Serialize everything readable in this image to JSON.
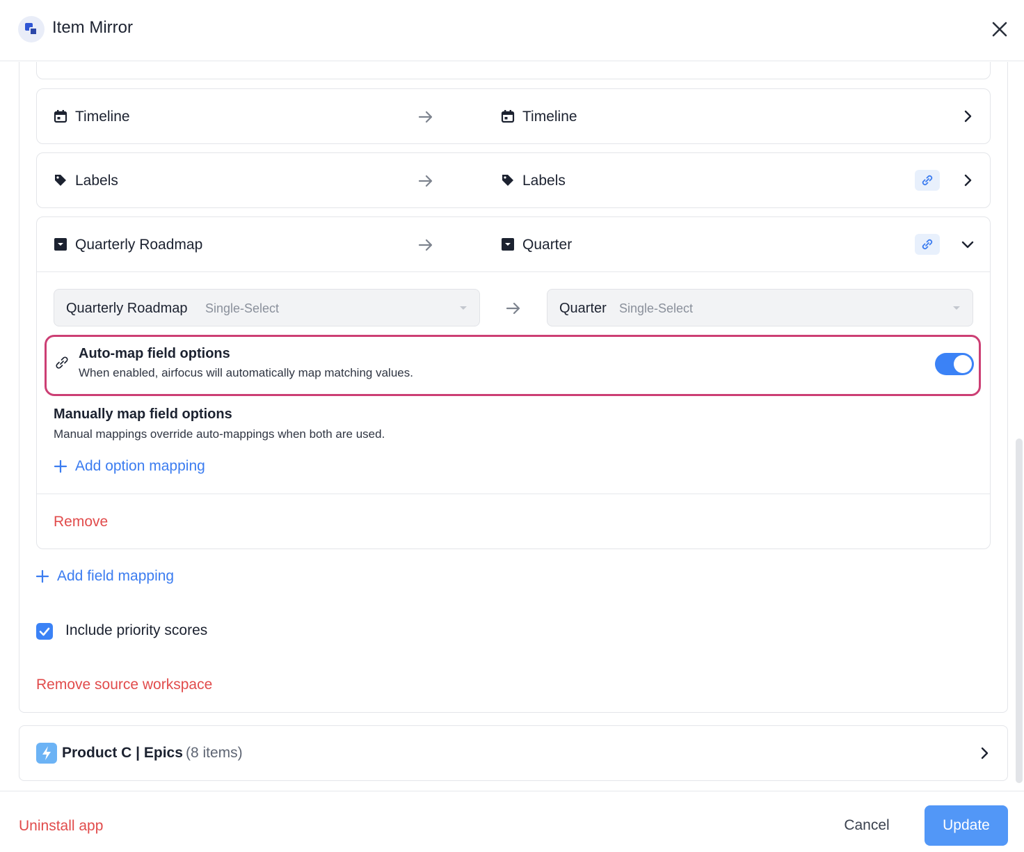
{
  "header": {
    "title": "Item Mirror"
  },
  "mappings": [
    {
      "source": "Timeline",
      "target": "Timeline",
      "source_icon": "calendar-icon",
      "target_icon": "calendar-icon",
      "linked": false,
      "expanded": false
    },
    {
      "source": "Labels",
      "target": "Labels",
      "source_icon": "tag-icon",
      "target_icon": "tag-icon",
      "linked": true,
      "expanded": false
    },
    {
      "source": "Quarterly Roadmap",
      "target": "Quarter",
      "source_icon": "dropdown-select-icon",
      "target_icon": "dropdown-select-icon",
      "linked": true,
      "expanded": true,
      "detail": {
        "source_field": {
          "value": "Quarterly Roadmap",
          "type": "Single-Select"
        },
        "target_field": {
          "value": "Quarter",
          "type": "Single-Select"
        },
        "automap": {
          "title": "Auto-map field options",
          "description": "When enabled, airfocus will automatically map matching values.",
          "enabled": true
        },
        "manual": {
          "title": "Manually map field options",
          "description": "Manual mappings override auto-mappings when both are used.",
          "add_label": "Add option mapping"
        },
        "remove_label": "Remove"
      }
    }
  ],
  "add_field_mapping": "Add field mapping",
  "include_priority": {
    "label": "Include priority scores",
    "checked": true
  },
  "remove_source": "Remove source workspace",
  "epics": {
    "name": "Product C | Epics",
    "count": "(8 items)",
    "icon": "lightning-icon"
  },
  "footer": {
    "uninstall": "Uninstall app",
    "cancel": "Cancel",
    "update": "Update"
  },
  "colors": {
    "accent": "#3b82f6",
    "danger": "#e14b4b",
    "highlight": "#cc3f74"
  }
}
